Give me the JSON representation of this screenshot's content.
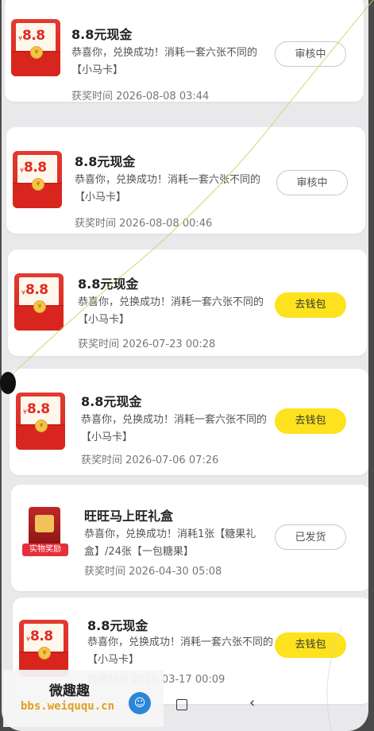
{
  "colors": {
    "accent_yellow": "#fde21d",
    "envelope_red": "#d8261f",
    "page_bg": "#e9e9ec"
  },
  "records": [
    {
      "title": "8.8元现金",
      "desc": "恭喜你，兑换成功！消耗一套六张不同的【小马卡】",
      "time": "获奖时间 2026-08-08 03:44",
      "button": "审核中",
      "style": "outline",
      "thumb_amount": "8.8",
      "thumb_icon": "red-envelope-icon"
    },
    {
      "title": "8.8元现金",
      "desc": "恭喜你，兑换成功！消耗一套六张不同的【小马卡】",
      "time": "获奖时间 2026-08-08 00:46",
      "button": "审核中",
      "style": "outline",
      "thumb_amount": "8.8",
      "thumb_icon": "red-envelope-icon"
    },
    {
      "title": "8.8元现金",
      "desc": "恭喜你，兑换成功！消耗一套六张不同的【小马卡】",
      "time": "获奖时间 2026-07-23 00:28",
      "button": "去钱包",
      "style": "yellow",
      "thumb_amount": "8.8",
      "thumb_icon": "red-envelope-icon"
    },
    {
      "title": "8.8元现金",
      "desc": "恭喜你，兑换成功！消耗一套六张不同的【小马卡】",
      "time": "获奖时间 2026-07-06 07:26",
      "button": "去钱包",
      "style": "yellow",
      "thumb_amount": "8.8",
      "thumb_icon": "red-envelope-icon"
    },
    {
      "title": "旺旺马上旺礼盒",
      "desc": "恭喜你，兑换成功！消耗1张【糖果礼盒】/24张【一包糖果】",
      "time": "获奖时间 2026-04-30 05:08",
      "button": "已发货",
      "style": "outline",
      "thumb_tag": "实物奖励",
      "thumb_icon": "gift-box-icon"
    },
    {
      "title": "8.8元现金",
      "desc": "恭喜你，兑换成功！消耗一套六张不同的【小马卡】",
      "time": "获奖时间 2026-03-17 00:09",
      "button": "去钱包",
      "style": "yellow",
      "thumb_amount": "8.8",
      "thumb_icon": "red-envelope-icon"
    }
  ],
  "watermark": {
    "line1": "微趣趣",
    "line2": "bbs.weiququ.cn"
  },
  "navbar": {
    "home_icon": "home-square-icon",
    "back_icon": "back-chevron-icon"
  }
}
